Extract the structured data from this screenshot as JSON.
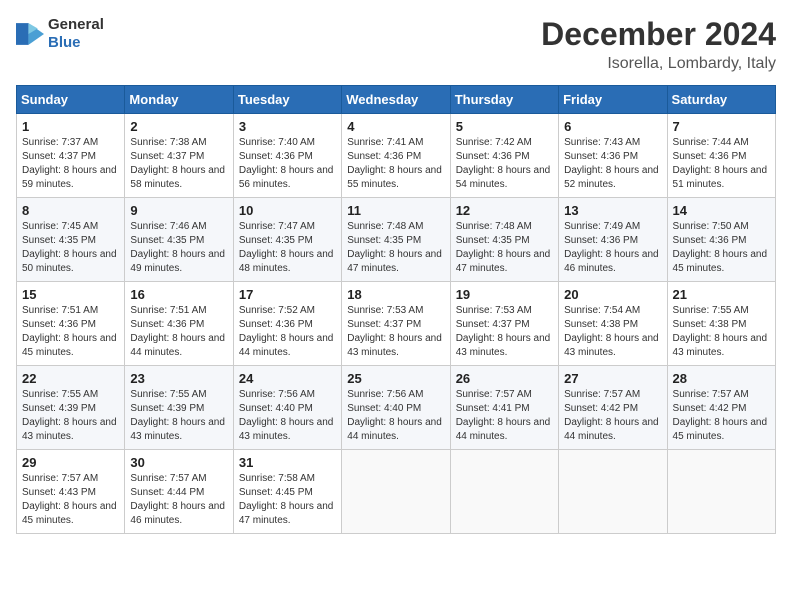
{
  "header": {
    "logo": {
      "general": "General",
      "blue": "Blue"
    },
    "title": "December 2024",
    "location": "Isorella, Lombardy, Italy"
  },
  "days_of_week": [
    "Sunday",
    "Monday",
    "Tuesday",
    "Wednesday",
    "Thursday",
    "Friday",
    "Saturday"
  ],
  "weeks": [
    [
      {
        "day": "1",
        "sunrise": "7:37 AM",
        "sunset": "4:37 PM",
        "daylight": "8 hours and 59 minutes."
      },
      {
        "day": "2",
        "sunrise": "7:38 AM",
        "sunset": "4:37 PM",
        "daylight": "8 hours and 58 minutes."
      },
      {
        "day": "3",
        "sunrise": "7:40 AM",
        "sunset": "4:36 PM",
        "daylight": "8 hours and 56 minutes."
      },
      {
        "day": "4",
        "sunrise": "7:41 AM",
        "sunset": "4:36 PM",
        "daylight": "8 hours and 55 minutes."
      },
      {
        "day": "5",
        "sunrise": "7:42 AM",
        "sunset": "4:36 PM",
        "daylight": "8 hours and 54 minutes."
      },
      {
        "day": "6",
        "sunrise": "7:43 AM",
        "sunset": "4:36 PM",
        "daylight": "8 hours and 52 minutes."
      },
      {
        "day": "7",
        "sunrise": "7:44 AM",
        "sunset": "4:36 PM",
        "daylight": "8 hours and 51 minutes."
      }
    ],
    [
      {
        "day": "8",
        "sunrise": "7:45 AM",
        "sunset": "4:35 PM",
        "daylight": "8 hours and 50 minutes."
      },
      {
        "day": "9",
        "sunrise": "7:46 AM",
        "sunset": "4:35 PM",
        "daylight": "8 hours and 49 minutes."
      },
      {
        "day": "10",
        "sunrise": "7:47 AM",
        "sunset": "4:35 PM",
        "daylight": "8 hours and 48 minutes."
      },
      {
        "day": "11",
        "sunrise": "7:48 AM",
        "sunset": "4:35 PM",
        "daylight": "8 hours and 47 minutes."
      },
      {
        "day": "12",
        "sunrise": "7:48 AM",
        "sunset": "4:35 PM",
        "daylight": "8 hours and 47 minutes."
      },
      {
        "day": "13",
        "sunrise": "7:49 AM",
        "sunset": "4:36 PM",
        "daylight": "8 hours and 46 minutes."
      },
      {
        "day": "14",
        "sunrise": "7:50 AM",
        "sunset": "4:36 PM",
        "daylight": "8 hours and 45 minutes."
      }
    ],
    [
      {
        "day": "15",
        "sunrise": "7:51 AM",
        "sunset": "4:36 PM",
        "daylight": "8 hours and 45 minutes."
      },
      {
        "day": "16",
        "sunrise": "7:51 AM",
        "sunset": "4:36 PM",
        "daylight": "8 hours and 44 minutes."
      },
      {
        "day": "17",
        "sunrise": "7:52 AM",
        "sunset": "4:36 PM",
        "daylight": "8 hours and 44 minutes."
      },
      {
        "day": "18",
        "sunrise": "7:53 AM",
        "sunset": "4:37 PM",
        "daylight": "8 hours and 43 minutes."
      },
      {
        "day": "19",
        "sunrise": "7:53 AM",
        "sunset": "4:37 PM",
        "daylight": "8 hours and 43 minutes."
      },
      {
        "day": "20",
        "sunrise": "7:54 AM",
        "sunset": "4:38 PM",
        "daylight": "8 hours and 43 minutes."
      },
      {
        "day": "21",
        "sunrise": "7:55 AM",
        "sunset": "4:38 PM",
        "daylight": "8 hours and 43 minutes."
      }
    ],
    [
      {
        "day": "22",
        "sunrise": "7:55 AM",
        "sunset": "4:39 PM",
        "daylight": "8 hours and 43 minutes."
      },
      {
        "day": "23",
        "sunrise": "7:55 AM",
        "sunset": "4:39 PM",
        "daylight": "8 hours and 43 minutes."
      },
      {
        "day": "24",
        "sunrise": "7:56 AM",
        "sunset": "4:40 PM",
        "daylight": "8 hours and 43 minutes."
      },
      {
        "day": "25",
        "sunrise": "7:56 AM",
        "sunset": "4:40 PM",
        "daylight": "8 hours and 44 minutes."
      },
      {
        "day": "26",
        "sunrise": "7:57 AM",
        "sunset": "4:41 PM",
        "daylight": "8 hours and 44 minutes."
      },
      {
        "day": "27",
        "sunrise": "7:57 AM",
        "sunset": "4:42 PM",
        "daylight": "8 hours and 44 minutes."
      },
      {
        "day": "28",
        "sunrise": "7:57 AM",
        "sunset": "4:42 PM",
        "daylight": "8 hours and 45 minutes."
      }
    ],
    [
      {
        "day": "29",
        "sunrise": "7:57 AM",
        "sunset": "4:43 PM",
        "daylight": "8 hours and 45 minutes."
      },
      {
        "day": "30",
        "sunrise": "7:57 AM",
        "sunset": "4:44 PM",
        "daylight": "8 hours and 46 minutes."
      },
      {
        "day": "31",
        "sunrise": "7:58 AM",
        "sunset": "4:45 PM",
        "daylight": "8 hours and 47 minutes."
      },
      null,
      null,
      null,
      null
    ]
  ],
  "labels": {
    "sunrise": "Sunrise:",
    "sunset": "Sunset:",
    "daylight": "Daylight:"
  }
}
